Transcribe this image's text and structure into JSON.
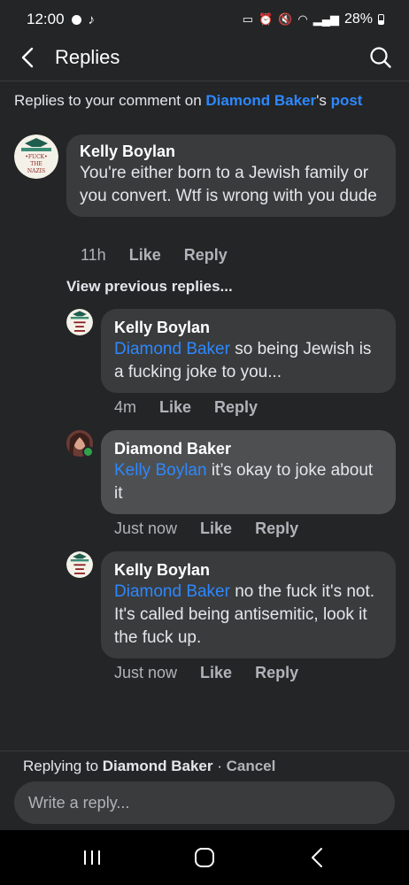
{
  "status_bar": {
    "time": "12:00",
    "battery": "28%"
  },
  "header": {
    "title": "Replies"
  },
  "context": {
    "prefix": "Replies to your comment on ",
    "person": "Diamond Baker",
    "possessive": "'s ",
    "post_link": "post"
  },
  "comments": [
    {
      "author": "Kelly Boylan",
      "mention": "",
      "text": "You're either born to a Jewish family or you convert. Wtf is wrong with you dude",
      "time": "11h",
      "like": "Like",
      "reply": "Reply"
    },
    {
      "author": "Kelly Boylan",
      "mention": "Diamond Baker",
      "text": " so being Jewish is a fucking joke to you...",
      "time": "4m",
      "like": "Like",
      "reply": "Reply"
    },
    {
      "author": "Diamond Baker",
      "mention": "Kelly Boylan",
      "text": " it’s okay to joke about it",
      "time": "Just now",
      "like": "Like",
      "reply": "Reply"
    },
    {
      "author": "Kelly Boylan",
      "mention": "Diamond Baker",
      "text": " no the fuck it's not. It's called being antisemitic, look it the fuck up.",
      "time": "Just now",
      "like": "Like",
      "reply": "Reply"
    }
  ],
  "view_previous": "View previous replies...",
  "reply_bar": {
    "prefix": "Replying to ",
    "name": "Diamond Baker",
    "separator": " · ",
    "cancel": "Cancel",
    "placeholder": "Write a reply..."
  },
  "avatar_text": {
    "kelly": "FUCK THE NAZIS"
  },
  "icons": {
    "back": "back-arrow-icon",
    "search": "search-icon",
    "nav_recents": "recents-icon",
    "nav_home": "home-icon",
    "nav_back": "nav-back-icon"
  },
  "colors": {
    "background": "#242526",
    "bubble": "#3a3b3c",
    "bubble_highlight": "#4e4f50",
    "link": "#2d88ff",
    "online": "#31a24c"
  }
}
